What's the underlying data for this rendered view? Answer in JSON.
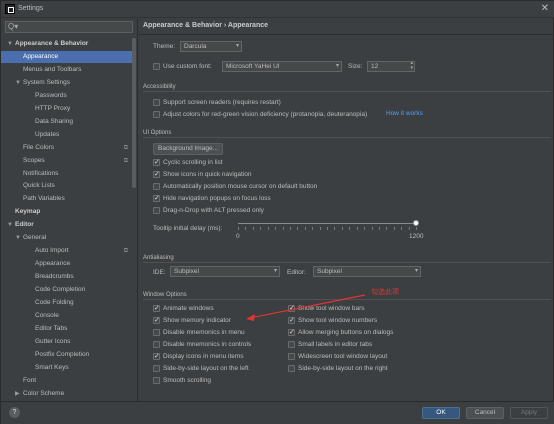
{
  "window": {
    "title": "Settings",
    "close": "✕"
  },
  "search": {
    "icon": "Q▾"
  },
  "sidebar": {
    "items": [
      {
        "label": "Appearance & Behavior",
        "level": 0,
        "bold": true,
        "arrow": "▼"
      },
      {
        "label": "Appearance",
        "level": 1,
        "selected": true
      },
      {
        "label": "Menus and Toolbars",
        "level": 1
      },
      {
        "label": "System Settings",
        "level": 1,
        "arrow": "▼"
      },
      {
        "label": "Passwords",
        "level": 2
      },
      {
        "label": "HTTP Proxy",
        "level": 2
      },
      {
        "label": "Data Sharing",
        "level": 2
      },
      {
        "label": "Updates",
        "level": 2
      },
      {
        "label": "File Colors",
        "level": 1,
        "copy": true
      },
      {
        "label": "Scopes",
        "level": 1,
        "copy": true
      },
      {
        "label": "Notifications",
        "level": 1
      },
      {
        "label": "Quick Lists",
        "level": 1
      },
      {
        "label": "Path Variables",
        "level": 1
      },
      {
        "label": "Keymap",
        "level": 0,
        "bold": true
      },
      {
        "label": "Editor",
        "level": 0,
        "bold": true,
        "arrow": "▼"
      },
      {
        "label": "General",
        "level": 1,
        "arrow": "▼"
      },
      {
        "label": "Auto Import",
        "level": 2,
        "copy": true
      },
      {
        "label": "Appearance",
        "level": 2
      },
      {
        "label": "Breadcrumbs",
        "level": 2
      },
      {
        "label": "Code Completion",
        "level": 2
      },
      {
        "label": "Code Folding",
        "level": 2
      },
      {
        "label": "Console",
        "level": 2
      },
      {
        "label": "Editor Tabs",
        "level": 2
      },
      {
        "label": "Gutter Icons",
        "level": 2
      },
      {
        "label": "Postfix Completion",
        "level": 2
      },
      {
        "label": "Smart Keys",
        "level": 2
      },
      {
        "label": "Font",
        "level": 1
      },
      {
        "label": "Color Scheme",
        "level": 1,
        "arrow": "▶"
      }
    ]
  },
  "breadcrumb": "Appearance & Behavior  ›  Appearance",
  "theme": {
    "label": "Theme:",
    "value": "Darcula"
  },
  "custom_font": {
    "label": "Use custom font:",
    "value": "Microsoft YaHei UI",
    "size_label": "Size:",
    "size_value": "12"
  },
  "accessibility": {
    "title": "Accessibility",
    "support_screen_readers": "Support screen readers (requires restart)",
    "adjust_colors": "Adjust colors for red-green vision deficiency (protanopia, deuteranopia)",
    "how_it_works": "How it works"
  },
  "ui_options": {
    "title": "UI Options",
    "background_image": "Background Image...",
    "cyclic_scrolling": "Cyclic scrolling in list",
    "show_icons_quick_nav": "Show icons in quick navigation",
    "auto_position_mouse": "Automatically position mouse cursor on default button",
    "hide_nav_popups": "Hide navigation popups on focus loss",
    "drag_n_drop_alt": "Drag-n-Drop with ALT pressed only",
    "tooltip_label": "Tooltip initial delay (ms):",
    "tooltip_min": "0",
    "tooltip_max": "1200",
    "tooltip_value_fraction": 1.0
  },
  "antialiasing": {
    "title": "Antialiasing",
    "ide_label": "IDE:",
    "ide_value": "Subpixel",
    "editor_label": "Editor:",
    "editor_value": "Subpixel"
  },
  "window_options": {
    "title": "Window Options",
    "animate_windows": "Animate windows",
    "show_memory_indicator": "Show memory indicator",
    "disable_mnemonics_menu": "Disable mnemonics in menu",
    "disable_mnemonics_controls": "Disable mnemonics in controls",
    "display_icons_menu": "Display icons in menu items",
    "side_by_side_left": "Side-by-side layout on the left",
    "smooth_scrolling": "Smooth scrolling",
    "show_tool_window_bars": "Show tool window bars",
    "show_tool_window_numbers": "Show tool window numbers",
    "allow_merging_buttons": "Allow merging buttons on dialogs",
    "small_labels_editor_tabs": "Small labels in editor tabs",
    "widescreen_layout": "Widescreen tool window layout",
    "side_by_side_right": "Side-by-side layout on the right"
  },
  "annotation": "勾选此项",
  "footer": {
    "help": "?",
    "ok": "OK",
    "cancel": "Cancel",
    "apply": "Apply"
  },
  "colors": {
    "accent": "#4b6eaf",
    "ok_button": "#365880",
    "link": "#589df6",
    "annotation": "#e53232"
  }
}
